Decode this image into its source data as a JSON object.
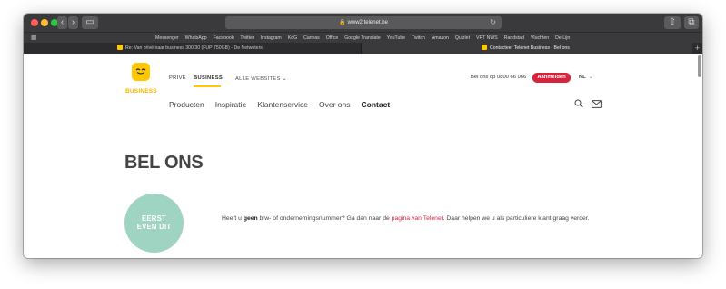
{
  "browser": {
    "address": "www2.telenet.be",
    "bookmarks": [
      "Messenger",
      "WhatsApp",
      "Facebook",
      "Twitter",
      "Instagram",
      "KdG",
      "Canvas",
      "Office",
      "Google Translate",
      "YouTube",
      "Twitch",
      "Amazon",
      "Quizlet",
      "VRT NWS",
      "Randstad",
      "Vluchten",
      "De Lijn"
    ],
    "tabs": [
      {
        "title": "Re: Van privé naar business 300/30 (FUP 750GB) - De Netweters"
      },
      {
        "title": "Contacteer Telenet Business - Bel ons"
      }
    ]
  },
  "site": {
    "logo_text": "BUSINESS",
    "topnav": {
      "prive": "PRIVÉ",
      "business": "BUSINESS",
      "alle": "ALLE WEBSITES"
    },
    "call_us": "Bel ons op 0800 66 066",
    "login_label": "Aanmelden",
    "language": "NL",
    "mainnav": [
      "Producten",
      "Inspiratie",
      "Klantenservice",
      "Over ons",
      "Contact"
    ],
    "headline": "BEL ONS",
    "badge": {
      "line1": "EERST",
      "line2": "EVEN DIT"
    },
    "info": {
      "part1": "Heeft u ",
      "bold": "geen",
      "part2": " btw- of ondernemingsnummer? Ga dan naar de ",
      "link": "pagina van Telenet",
      "part3": ". Daar helpen we u als particuliere klant graag verder."
    }
  },
  "colors": {
    "brand_yellow": "#ffc800",
    "cta_red": "#d6243f",
    "badge_green": "#9fd4c2"
  }
}
